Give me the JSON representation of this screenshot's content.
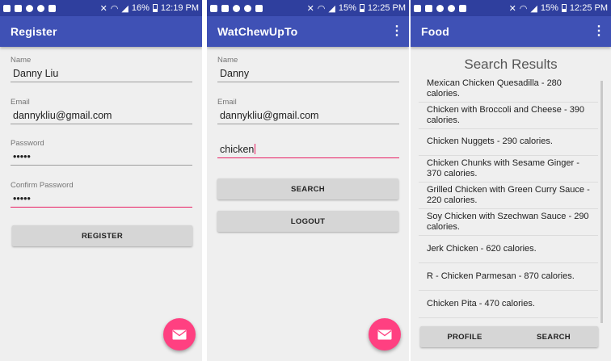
{
  "colors": {
    "status_bar": "#2f3f9e",
    "app_bar": "#3f51b5",
    "accent": "#e91e63",
    "fab": "#ff4081"
  },
  "screens": [
    {
      "status": {
        "battery": "16%",
        "time": "12:19 PM"
      },
      "app_bar_title": "Register",
      "fields": [
        {
          "label": "Name",
          "value": "Danny Liu"
        },
        {
          "label": "Email",
          "value": "dannykliu@gmail.com"
        },
        {
          "label": "Password",
          "value": "•••••"
        },
        {
          "label": "Confirm Password",
          "value": "•••••"
        }
      ],
      "button": "REGISTER",
      "fab_icon": "mail-icon"
    },
    {
      "status": {
        "battery": "15%",
        "time": "12:25 PM"
      },
      "app_bar_title": "WatChewUpTo",
      "fields": [
        {
          "label": "Name",
          "value": "Danny"
        },
        {
          "label": "Email",
          "value": "dannykliu@gmail.com"
        }
      ],
      "search_value": "chicken",
      "buttons": [
        "SEARCH",
        "LOGOUT"
      ],
      "fab_icon": "mail-icon"
    },
    {
      "status": {
        "battery": "15%",
        "time": "12:25 PM"
      },
      "app_bar_title": "Food",
      "results_title": "Search Results",
      "results": [
        "Mexican Chicken Quesadilla - 280 calories.",
        "Chicken with Broccoli and Cheese - 390 calories.",
        "Chicken Nuggets - 290 calories.",
        "Chicken Chunks with Sesame Ginger - 370 calories.",
        "Grilled Chicken with Green Curry Sauce - 220 calories.",
        "Soy Chicken with Szechwan Sauce - 290 calories.",
        "Jerk Chicken - 620 calories.",
        "R - Chicken Parmesan - 870 calories.",
        "Chicken Pita - 470 calories."
      ],
      "bottom_buttons": [
        "PROFILE",
        "SEARCH"
      ]
    }
  ]
}
